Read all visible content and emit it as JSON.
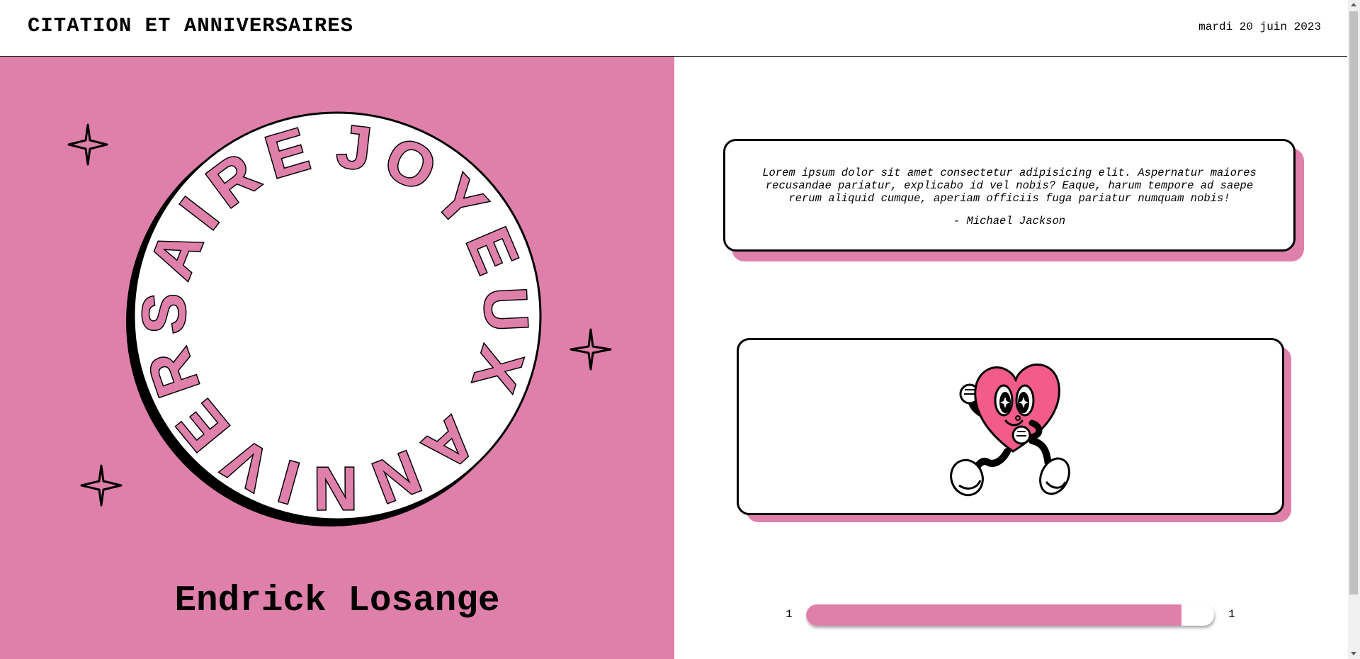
{
  "header": {
    "title": "CITATION ET ANNIVERSAIRES",
    "date": "mardi 20 juin 2023"
  },
  "birthday": {
    "badge_text": "JOYEUX ANNIVERSAIRE",
    "name": "Endrick Losange"
  },
  "quote": {
    "text": "Lorem ipsum dolor sit amet consectetur adipisicing elit. Aspernatur maiores recusandae pariatur, explicabo id vel nobis? Eaque, harum tempore ad saepe rerum aliquid cumque, aperiam officiis fuga pariatur numquam nobis!",
    "author": "- Michael Jackson"
  },
  "illustration": {
    "icon": "running-heart-mascot-icon"
  },
  "pager": {
    "min_label": "1",
    "max_label": "1",
    "progress_fraction": 0.92
  },
  "colors": {
    "accent": "#df80ab",
    "heart": "#f25b8a",
    "background": "#ffffff",
    "ink": "#000000"
  }
}
